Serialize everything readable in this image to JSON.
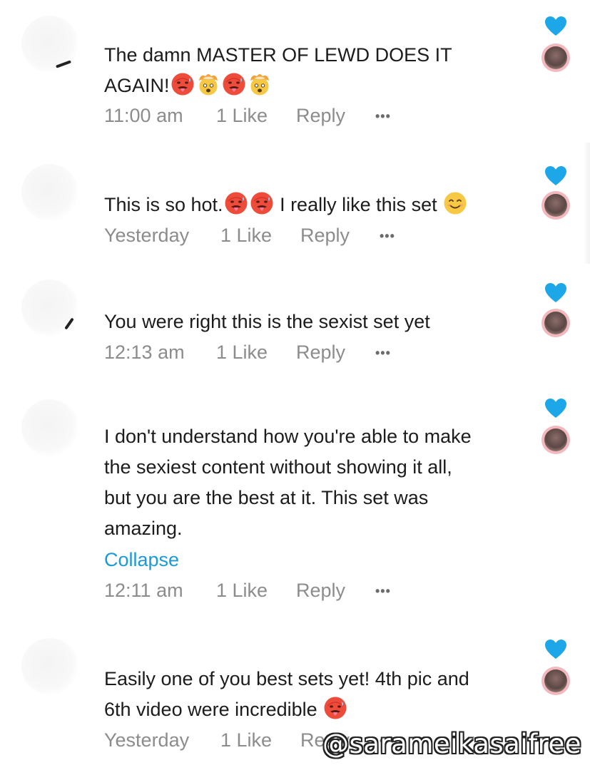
{
  "colors": {
    "heart": "#1ea7e8",
    "link": "#1a9bd7",
    "meta_text": "#8c8c8c",
    "body_text": "#1c1c1c"
  },
  "comments": [
    {
      "text_lines": [
        "The damn MASTER OF LEWD DOES IT",
        "AGAIN!"
      ],
      "emojis_line2": [
        "hot-face-emoji",
        "exploding-head-emoji",
        "hot-face-emoji",
        "exploding-head-emoji"
      ],
      "time": "11:00 am",
      "likes": "1 Like",
      "reply": "Reply",
      "more": "•••"
    },
    {
      "text_part1": "This is so hot.",
      "emojis_mid": [
        "hot-face-emoji",
        "hot-face-emoji"
      ],
      "text_part2": " I really like this set ",
      "emoji_end": "smiling-face-emoji",
      "time": "Yesterday",
      "likes": "1 Like",
      "reply": "Reply",
      "more": "•••"
    },
    {
      "text": "You were right this is the sexist set yet",
      "time": "12:13 am",
      "likes": "1 Like",
      "reply": "Reply",
      "more": "•••"
    },
    {
      "text_lines": [
        "I don't understand how you're able to make",
        "the sexiest content without showing it all,",
        "but you are the best at it. This set was",
        "amazing."
      ],
      "collapse": "Collapse",
      "time": "12:11 am",
      "likes": "1 Like",
      "reply": "Reply",
      "more": "•••"
    },
    {
      "text_lines": [
        "Easily one of you best sets yet! 4th pic and",
        "6th video were incredible"
      ],
      "emoji_end": "hot-face-emoji",
      "time": "Yesterday",
      "likes": "1 Like",
      "reply": "Reply",
      "more": "•••"
    }
  ],
  "icons": {
    "heart": "heart-icon",
    "avatar": "creator-avatar-icon"
  },
  "watermark": "@sarameikasaifree"
}
